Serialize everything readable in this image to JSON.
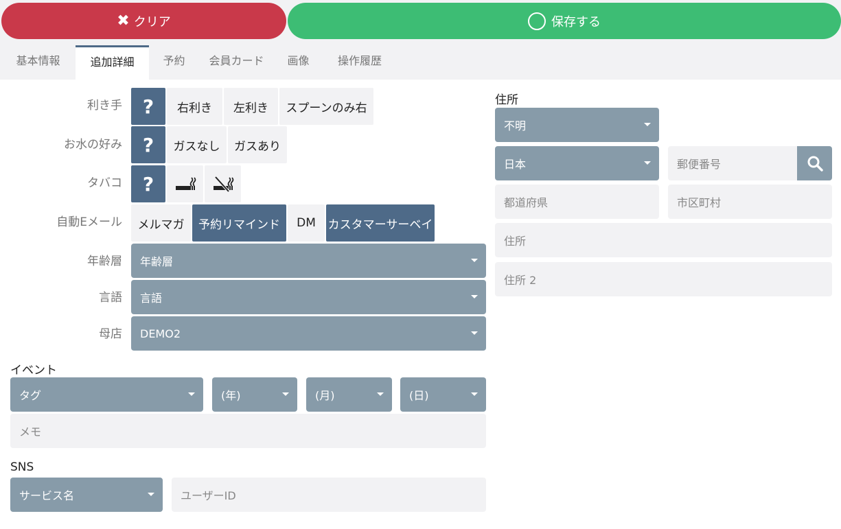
{
  "toolbar": {
    "clear_label": "クリア",
    "save_label": "保存する"
  },
  "tabs": [
    {
      "label": "基本情報"
    },
    {
      "label": "追加詳細"
    },
    {
      "label": "予約"
    },
    {
      "label": "会員カード"
    },
    {
      "label": "画像"
    },
    {
      "label": "操作履歴"
    }
  ],
  "active_tab": "追加詳細",
  "form": {
    "handedness": {
      "label": "利き手",
      "unknown": "?",
      "options": [
        "右利き",
        "左利き",
        "スプーンのみ右"
      ]
    },
    "water": {
      "label": "お水の好み",
      "unknown": "?",
      "options": [
        "ガスなし",
        "ガスあり"
      ]
    },
    "tobacco": {
      "label": "タバコ",
      "unknown": "?"
    },
    "auto_email": {
      "label": "自動Eメール",
      "options": [
        "メルマガ",
        "予約リマインド",
        "DM",
        "カスタマーサーベイ"
      ]
    },
    "age": {
      "label": "年齢層",
      "value": "年齢層"
    },
    "language": {
      "label": "言語",
      "value": "言語"
    },
    "home_store": {
      "label": "母店",
      "value": "DEMO2"
    }
  },
  "event": {
    "label": "イベント",
    "tag": "タグ",
    "year": "(年)",
    "month": "(月)",
    "day": "(日)",
    "memo_placeholder": "メモ"
  },
  "sns": {
    "label": "SNS",
    "service": "サービス名",
    "user_id_placeholder": "ユーザーID"
  },
  "address": {
    "label": "住所",
    "type": "不明",
    "country": "日本",
    "postal_placeholder": "郵便番号",
    "prefecture_placeholder": "都道府県",
    "city_placeholder": "市区町村",
    "address1_placeholder": "住所",
    "address2_placeholder": "住所 2"
  },
  "colors": {
    "clear": "#c9394a",
    "save": "#3dbd74",
    "active": "#4e6a88",
    "select": "#879ba9",
    "input": "#f2f2f4"
  }
}
